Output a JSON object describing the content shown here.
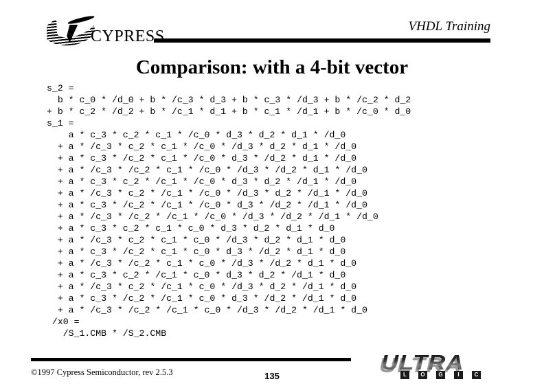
{
  "header": {
    "brand": "CYPRESS",
    "course_title": "VHDL Training"
  },
  "slide": {
    "title": "Comparison: with a 4-bit vector"
  },
  "code": {
    "lines": [
      "s_2 =",
      "  b * c_0 * /d_0 + b * /c_3 * d_3 + b * c_3 * /d_3 + b * /c_2 * d_2",
      "+ b * c_2 * /d_2 + b * /c_1 * d_1 + b * c_1 * /d_1 + b * /c_0 * d_0",
      "s_1 =",
      "    a * c_3 * c_2 * c_1 * /c_0 * d_3 * d_2 * d_1 * /d_0",
      "  + a * /c_3 * c_2 * c_1 * /c_0 * /d_3 * d_2 * d_1 * /d_0",
      "  + a * c_3 * /c_2 * c_1 * /c_0 * d_3 * /d_2 * d_1 * /d_0",
      "  + a * /c_3 * /c_2 * c_1 * /c_0 * /d_3 * /d_2 * d_1 * /d_0",
      "  + a * c_3 * c_2 * /c_1 * /c_0 * d_3 * d_2 * /d_1 * /d_0",
      "  + a * /c_3 * c_2 * /c_1 * /c_0 * /d_3 * d_2 * /d_1 * /d_0",
      "  + a * c_3 * /c_2 * /c_1 * /c_0 * d_3 * /d_2 * /d_1 * /d_0",
      "  + a * /c_3 * /c_2 * /c_1 * /c_0 * /d_3 * /d_2 * /d_1 * /d_0",
      "  + a * c_3 * c_2 * c_1 * c_0 * d_3 * d_2 * d_1 * d_0",
      "  + a * /c_3 * c_2 * c_1 * c_0 * /d_3 * d_2 * d_1 * d_0",
      "  + a * c_3 * /c_2 * c_1 * c_0 * d_3 * /d_2 * d_1 * d_0",
      "  + a * /c_3 * /c_2 * c_1 * c_0 * /d_3 * /d_2 * d_1 * d_0",
      "  + a * c_3 * c_2 * /c_1 * c_0 * d_3 * d_2 * /d_1 * d_0",
      "  + a * /c_3 * c_2 * /c_1 * c_0 * /d_3 * d_2 * /d_1 * d_0",
      "  + a * c_3 * /c_2 * /c_1 * c_0 * d_3 * /d_2 * /d_1 * d_0",
      "  + a * /c_3 * /c_2 * /c_1 * c_0 * /d_3 * /d_2 * /d_1 * d_0",
      " /x0 =",
      "   /S_1.CMB * /S_2.CMB"
    ]
  },
  "footer": {
    "copyright": "©1997 Cypress Semiconductor, rev 2.5.3",
    "page_number": "135",
    "logo_word": "ULTRA",
    "logo_sub_letters": [
      "L",
      "O",
      "G",
      "I",
      "C"
    ]
  },
  "colors": {
    "ink": "#000000",
    "background": "#ffffff",
    "logo_gray": "#9a9a9a"
  }
}
